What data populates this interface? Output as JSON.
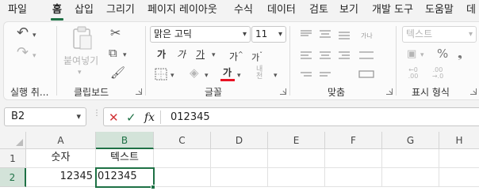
{
  "menu": {
    "items": [
      "파일",
      "홈",
      "삽입",
      "그리기",
      "페이지 레이아웃",
      "수식",
      "데이터",
      "검토",
      "보기",
      "개발 도구",
      "도움말",
      "데"
    ],
    "active_index": 1
  },
  "ribbon": {
    "groups": {
      "undo": "실행 취...",
      "clipboard": "클립보드",
      "font": "글꼴",
      "alignment": "맞춤",
      "number": "표시 형식"
    },
    "clipboard": {
      "paste_label": "붙여넣기"
    },
    "font": {
      "name": "맑은 고딕",
      "size": "11",
      "bold": "가",
      "italic": "가",
      "underline": "가",
      "grow": "가",
      "shrink": "가",
      "font_color_glyph": "가",
      "phonetic_glyph": "내천"
    },
    "number": {
      "format": "텍스트"
    },
    "colors": {
      "font_color": "#e81123",
      "accent": "#1e7145"
    }
  },
  "formula_bar": {
    "name_box": "B2",
    "cancel": "✕",
    "enter": "✓",
    "fx": "fx",
    "value": "012345"
  },
  "sheet": {
    "columns": [
      "A",
      "B",
      "C",
      "D",
      "E",
      "F",
      "G",
      "H"
    ],
    "rows": [
      "1",
      "2"
    ],
    "selected_column": "B",
    "selected_row": "2",
    "cells": {
      "A1": "숫자",
      "B1": "텍스트",
      "A2": "12345",
      "B2": "012345"
    }
  }
}
